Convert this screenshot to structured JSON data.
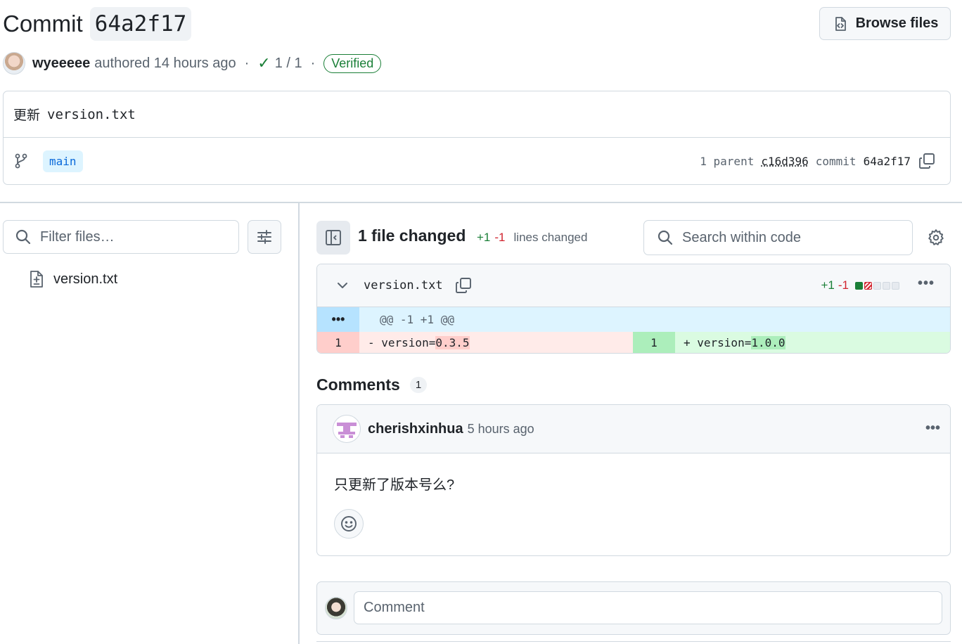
{
  "commit": {
    "title_prefix": "Commit",
    "sha": "64a2f17",
    "browse_files_label": "Browse files",
    "author": "wyeeeee",
    "authored_text": "authored 14 hours ago",
    "separator": "·",
    "checks": "1 / 1",
    "verified_label": "Verified",
    "message_prefix": "更新",
    "message_file": "version.txt",
    "branch": "main",
    "parent_label": "1 parent",
    "parent_sha": "c16d396",
    "commit_label": "commit",
    "commit_sha": "64a2f17"
  },
  "sidebar": {
    "filter_placeholder": "Filter files…",
    "files": [
      {
        "name": "version.txt"
      }
    ]
  },
  "toolbar": {
    "files_changed": "1 file changed",
    "additions": "+1",
    "deletions": "-1",
    "lines_changed_label": "lines changed",
    "search_placeholder": "Search within code"
  },
  "diff": {
    "file_name": "version.txt",
    "additions": "+1",
    "deletions": "-1",
    "more_label": "•••",
    "expand_label": "•••",
    "hunk_header": "@@ -1 +1 @@",
    "old_line_no": "1",
    "old_prefix": "- version=",
    "old_value": "0.3.5",
    "new_line_no": "1",
    "new_prefix": "+ version=",
    "new_value": "1.0.0"
  },
  "comments": {
    "heading": "Comments",
    "count": "1",
    "items": [
      {
        "user": "cherishxinhua",
        "time": "5 hours ago",
        "body": "只更新了版本号么?",
        "more_label": "•••"
      }
    ],
    "new_comment_placeholder": "Comment"
  },
  "colors": {
    "addition": "#1a7f37",
    "deletion": "#d1242f",
    "link": "#0969da",
    "border": "#d1d9e0"
  }
}
